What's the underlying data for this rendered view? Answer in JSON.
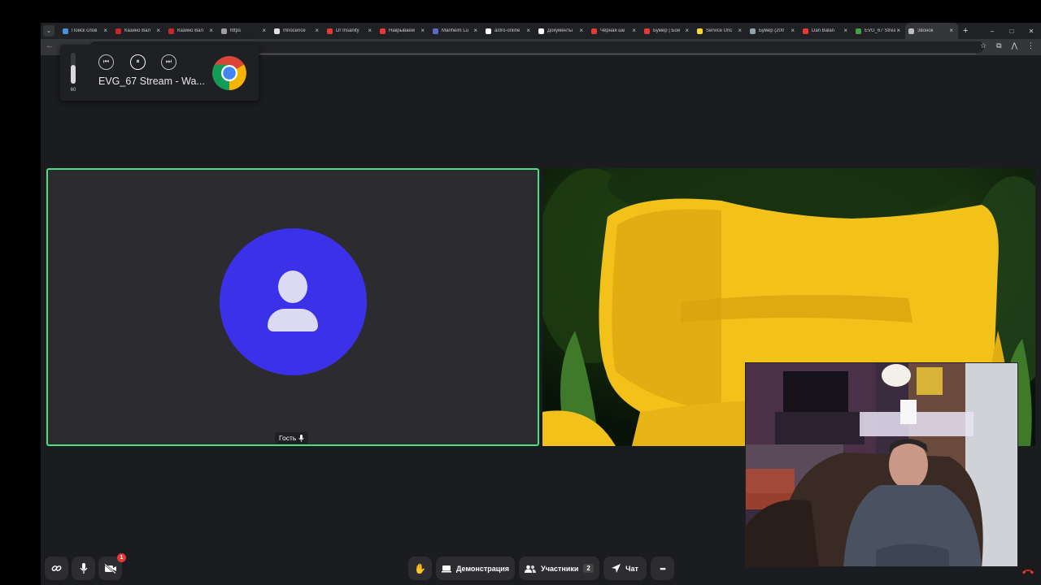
{
  "browser": {
    "tabs": [
      {
        "label": "Поиск слов",
        "color": "#4a90e2"
      },
      {
        "label": "Казино Вал",
        "color": "#c62828"
      },
      {
        "label": "Казино Вал",
        "color": "#c62828"
      },
      {
        "label": "https",
        "color": "#9e9e9e"
      },
      {
        "label": "Innocence",
        "color": "#e0e0e0"
      },
      {
        "label": "Dr Insanity",
        "color": "#e53935"
      },
      {
        "label": "Накрываем",
        "color": "#e53935"
      },
      {
        "label": "Manheim Lu",
        "color": "#5c6bc0"
      },
      {
        "label": "astro-online",
        "color": "#ffffff"
      },
      {
        "label": "Документы",
        "color": "#ffffff"
      },
      {
        "label": "Чёрная ше",
        "color": "#e53935"
      },
      {
        "label": "Бумер | Бои",
        "color": "#e53935"
      },
      {
        "label": "Service Unc",
        "color": "#fdd835"
      },
      {
        "label": "Бумер (200",
        "color": "#90a4ae"
      },
      {
        "label": "Dan Balan",
        "color": "#e53935"
      },
      {
        "label": "EVG_67 Strea",
        "color": "#43a047"
      },
      {
        "label": "Звонок",
        "color": "#bdbdbd"
      }
    ],
    "active_tab_index": 16,
    "tab_close_glyph": "×",
    "new_tab_glyph": "+",
    "window_controls": {
      "minimize": "–",
      "maximize": "□",
      "close": "✕"
    }
  },
  "media_popup": {
    "volume_level": "60",
    "volume_fraction": 0.6,
    "title": "EVG_67 Stream - Wa...",
    "prev_icon": "⏮",
    "pause_icon": "⏸",
    "next_icon": "⏭"
  },
  "call": {
    "guest_name": "Гость",
    "controls": {
      "demonstration_label": "Демонстрация",
      "participants_label": "Участники",
      "participants_count": "2",
      "chat_label": "Чат",
      "more_label": "•••",
      "video_badge": "1"
    }
  },
  "colors": {
    "active_speaker_border": "#4ee080",
    "avatar_bg": "#3a31e8",
    "hangup": "#e53935"
  }
}
